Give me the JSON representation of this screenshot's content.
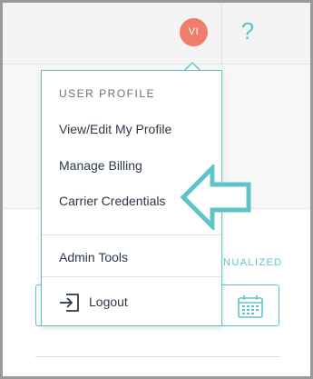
{
  "header": {
    "avatar_initials": "VI",
    "help_label": "?"
  },
  "dropdown": {
    "section_title": "USER PROFILE",
    "items": [
      {
        "label": "View/Edit My Profile"
      },
      {
        "label": "Manage Billing"
      },
      {
        "label": "Carrier Credentials"
      },
      {
        "label": "Admin Tools"
      }
    ],
    "logout_label": "Logout"
  },
  "background": {
    "annualized_label": "NUALIZED"
  },
  "colors": {
    "accent": "#5fc4c8",
    "avatar": "#ef7f6b",
    "text": "#2d3a4a"
  },
  "icons": [
    "help-icon",
    "logout-icon",
    "calendar-icon",
    "arrow-left-icon"
  ]
}
